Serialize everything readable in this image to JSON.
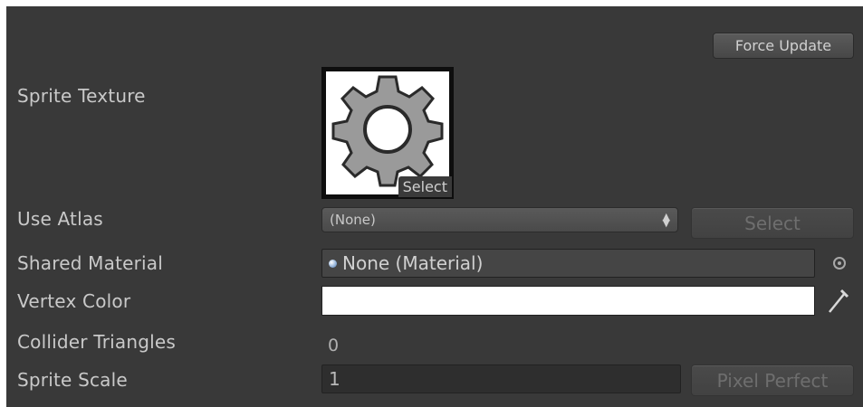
{
  "inspector": {
    "force_update_label": "Force Update",
    "sprite_texture": {
      "label": "Sprite Texture",
      "select_label": "Select",
      "preview_icon": "gear-icon"
    },
    "use_atlas": {
      "label": "Use Atlas",
      "selected": "(None)",
      "select_button": "Select"
    },
    "shared_material": {
      "label": "Shared Material",
      "value": "None (Material)",
      "object_icon": "material-sphere-icon",
      "picker_icon": "object-picker-icon"
    },
    "vertex_color": {
      "label": "Vertex Color",
      "color": "#ffffff",
      "picker_icon": "eyedropper-icon"
    },
    "collider_triangles": {
      "label": "Collider Triangles",
      "value": "0"
    },
    "sprite_scale": {
      "label": "Sprite Scale",
      "value": "1",
      "pixel_perfect_label": "Pixel Perfect"
    }
  }
}
